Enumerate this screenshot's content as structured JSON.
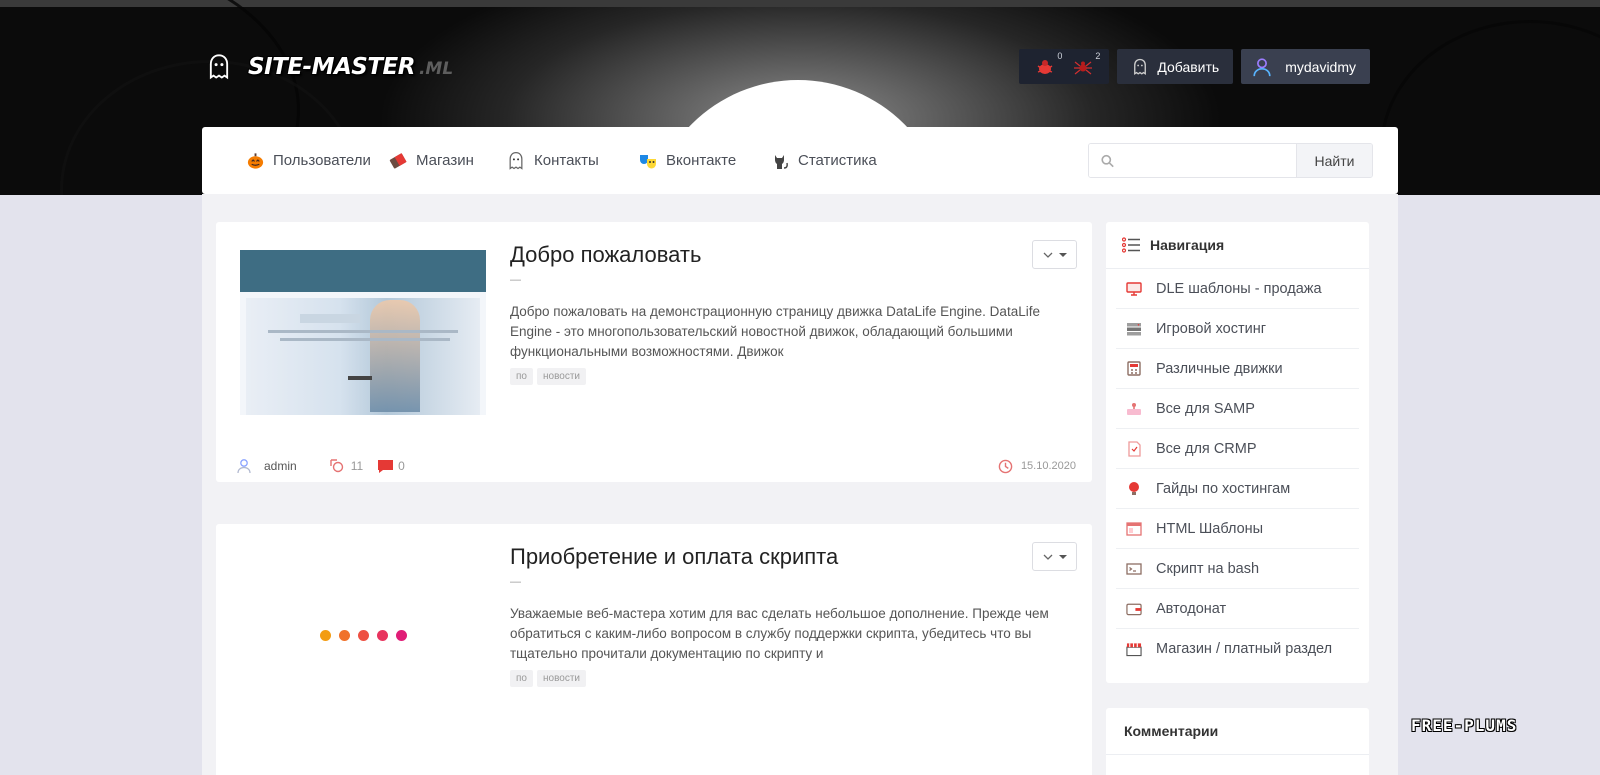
{
  "header": {
    "logo_main": "SITE-MASTER",
    "logo_ext": ".ML",
    "notifications": [
      {
        "icon": "bug-red-icon",
        "count": "0"
      },
      {
        "icon": "spider-icon",
        "count": "2"
      }
    ],
    "add_label": "Добавить",
    "username": "mydavidmy"
  },
  "nav": {
    "items": [
      {
        "label": "Пользователи",
        "icon": "pumpkin-icon"
      },
      {
        "label": "Магазин",
        "icon": "chocolate-icon"
      },
      {
        "label": "Контакты",
        "icon": "ghost-icon"
      },
      {
        "label": "Вконтакте",
        "icon": "masks-icon"
      },
      {
        "label": "Статистика",
        "icon": "cat-icon"
      }
    ],
    "search_placeholder": "",
    "search_button": "Найти"
  },
  "posts": [
    {
      "title": "Добро пожаловать",
      "dash": "—",
      "description": "Добро пожаловать на демонстрационную страницу движка DataLife Engine. DataLife Engine - это многопользовательский новостной движок, обладающий большими функциональными возможностями. Движок",
      "tags": [
        "по",
        "новости"
      ],
      "author": "admin",
      "views": "11",
      "comments": "0",
      "date": "15.10.2020"
    },
    {
      "title": "Приобретение и оплата скрипта",
      "dash": "—",
      "description": "Уважаемые веб-мастера хотим для вас сделать небольшое дополнение. Прежде чем обратиться с каким-либо вопросом в службу поддержки скрипта, убедитесь что вы тщательно прочитали документацию по скрипту и",
      "tags": [
        "по",
        "новости"
      ]
    }
  ],
  "sidebar": {
    "nav_title": "Навигация",
    "items": [
      {
        "label": "DLE шаблоны - продажа",
        "icon": "monitor-icon"
      },
      {
        "label": "Игровой хостинг",
        "icon": "server-icon"
      },
      {
        "label": "Различные движки",
        "icon": "calculator-icon"
      },
      {
        "label": "Все для SAMP",
        "icon": "joystick-icon"
      },
      {
        "label": "Все для CRMP",
        "icon": "document-icon"
      },
      {
        "label": "Гайды по хостингам",
        "icon": "lightbulb-icon"
      },
      {
        "label": "HTML Шаблоны",
        "icon": "browser-icon"
      },
      {
        "label": "Скрипт на bash",
        "icon": "terminal-icon"
      },
      {
        "label": "Автодонат",
        "icon": "wallet-icon"
      },
      {
        "label": "Магазин / платный раздел",
        "icon": "shop-icon"
      }
    ],
    "comments_title": "Комментарии"
  },
  "watermark": "FREE-PLUMS",
  "colors": {
    "accent_red": "#e74c3c",
    "dark_panel": "#1e2330",
    "user_btn": "#3a4050",
    "page_bg": "#e3e3ed"
  }
}
